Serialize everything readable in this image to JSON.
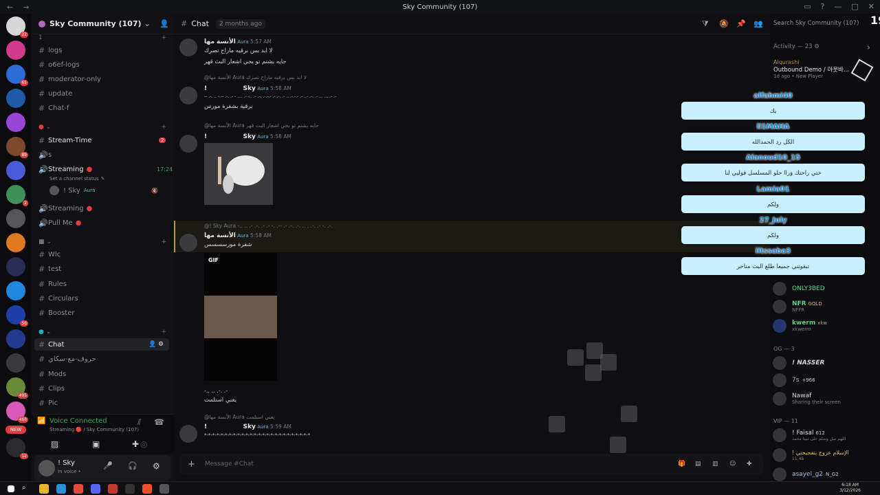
{
  "window": {
    "title": "Sky Community (107)",
    "logo": "19"
  },
  "guild": {
    "name": "Sky Community (107)"
  },
  "servers": [
    {
      "color": "#d7d7d7",
      "badge": "22"
    },
    {
      "color": "#d23a8a",
      "badge": ""
    },
    {
      "color": "#2b6cd6",
      "badge": "65"
    },
    {
      "color": "#1e5aa8",
      "badge": ""
    },
    {
      "color": "#9a46d8",
      "badge": ""
    },
    {
      "color": "#7b4a2e",
      "badge": "89"
    },
    {
      "color": "#4b5cd8",
      "badge": ""
    },
    {
      "color": "#3f8f5a",
      "badge": "2"
    },
    {
      "color": "#55555a",
      "badge": ""
    },
    {
      "color": "#e07a20",
      "badge": ""
    },
    {
      "color": "#2b2b55",
      "badge": ""
    },
    {
      "color": "#1e87e0",
      "badge": ""
    },
    {
      "color": "#1f3fa8",
      "badge": "56"
    },
    {
      "color": "#233a8f",
      "badge": ""
    },
    {
      "color": "#3a3a3e",
      "badge": ""
    },
    {
      "color": "#6a8a3a",
      "badge": "495"
    },
    {
      "color": "#d85ab8",
      "badge": "468"
    },
    {
      "color": "#2a2a2e",
      "badge": "12"
    }
  ],
  "new_label": "NEW",
  "channels": {
    "cat1": {
      "label": "1"
    },
    "logs": "logs",
    "o6ef": "o6ef-logs",
    "modonly": "moderator-only",
    "update": "update",
    "chatf": "Chat-f",
    "stream_time": "Stream-Time",
    "stream_time_badge": "2",
    "s": "s",
    "streaming": "Streaming",
    "streaming_time": "17:24",
    "channel_status": "Set a channel status",
    "voice_user": "! Sky",
    "voice_user_tag": "Aura",
    "streaming2": "Streaming",
    "pullme": "Pull Me",
    "wlc": "Wlc",
    "test": "test",
    "rules": "Rules",
    "circulars": "Circulars",
    "booster": "Booster",
    "chat": "Chat",
    "arabic": "حروف-مع-سكاي",
    "mods": "Mods",
    "clips": "Clips",
    "pic": "Pic"
  },
  "voice": {
    "status": "Voice Connected",
    "detail": "Streaming 🔴 / Sky Community (107)"
  },
  "user": {
    "name": "! Sky",
    "status": "In voice • "
  },
  "chat": {
    "channel": "Chat",
    "since": "2 months ago",
    "composer_placeholder": "Message #Chat",
    "gif_label": "GIF",
    "messages": [
      {
        "author": "الأنسة مها",
        "tag": "Aura",
        "time": "5:57 AM",
        "line1": "لا ابد بس برقيه ماراح تصرك",
        "line2": "جايه بشتم تو يجي اشعار البث قهر"
      },
      {
        "reply": "@الأنسة مها  Aura  لا ابد بس برقيه ماراح تصرك",
        "author": "Sky",
        "prefix": "!",
        "tag": "Aura",
        "time": "5:58 AM",
        "line1": "-- .-. .. -.-- .-. .- - .... .- -.. .- .-. .-.-.- .- .-. .- .. .-.-.- .- ..- .-. .- ... ... .- .-",
        "line2": "برقية بشفرة مورس"
      },
      {
        "reply": "@الأنسة مها  Aura  جايه بشتم تو يجي اشعار البث قهر",
        "author": "Sky",
        "prefix": "!",
        "tag": "Aura",
        "time": "5:58 AM"
      },
      {
        "reply": "@!  Sky  Aura  -.. .. .- .-. .- .- -. .-- .- .-. .-. .. . .-. .- -. .-.",
        "author": "الأنسة مها",
        "tag": "Aura",
        "time": "5:58 AM",
        "line1": "شفرة مورسسسس",
        "line2": "-.. .. .-. .-",
        "line3": "يعني استلمت"
      },
      {
        "reply": "@الأنسة مها  Aura  يعني استلمت",
        "author": "Sky",
        "prefix": "!",
        "tag": "Aura",
        "time": "5:59 AM",
        "line1": "*-*-*-*-*-*-*-*-*-*-*-*-*-*-*-*-*-*-*-*-*-*-*-*-*-*"
      }
    ]
  },
  "members": {
    "search_placeholder": "Search Sky Community (107)",
    "activity": "Activity — 23",
    "activity_user": "Alqurashi",
    "activity_title": "Outbound Demo / 아웃바...",
    "activity_meta": "1d ago  •  New Player",
    "list": [
      {
        "name": "ONLY3BED",
        "sub": "",
        "color": "#4ec07a"
      },
      {
        "name": "NFR",
        "sub": "NFFR",
        "tag": "GOLD",
        "color": "#5cd38a"
      },
      {
        "name": "kwerm",
        "sub": "xkwerm",
        "tag": "xkw",
        "color": "#5cd38a"
      }
    ],
    "og_header": "OG — 3",
    "og": [
      {
        "name": "! NASSER",
        "sub": ""
      },
      {
        "name": "7s",
        "tag": "+966",
        "sub": ""
      },
      {
        "name": "Nawaf",
        "sub": "Sharing their screen"
      }
    ],
    "vip_header": "VIP — 11",
    "vip": [
      {
        "name": "! Faisal",
        "tag": "612",
        "sub": "اللهم صلِ وسلم على نبينا محمد"
      },
      {
        "name": "! الإسلام عروج بتفحيحتي",
        "sub": "11:45"
      },
      {
        "name": "asayel_g2",
        "tag": "N_G2",
        "sub": ""
      }
    ]
  },
  "overlay": [
    {
      "name": "alfahmi40",
      "text": "يك"
    },
    {
      "name": "li1MAHA",
      "text": "الكل رد الحمدالله"
    },
    {
      "name": "Alanoud10_15",
      "text": "ختي راحتك وراا حلو المسلسل قوليي لنا"
    },
    {
      "name": "Lamia01",
      "text": "ولكم"
    },
    {
      "name": "27_July",
      "text": "ولكم"
    },
    {
      "name": "iitssaba3",
      "text": "تبقوتني جميعا طلع البث متاخر"
    }
  ],
  "taskbar": {
    "time": "6:18 AM",
    "date": "3/12/2026"
  }
}
